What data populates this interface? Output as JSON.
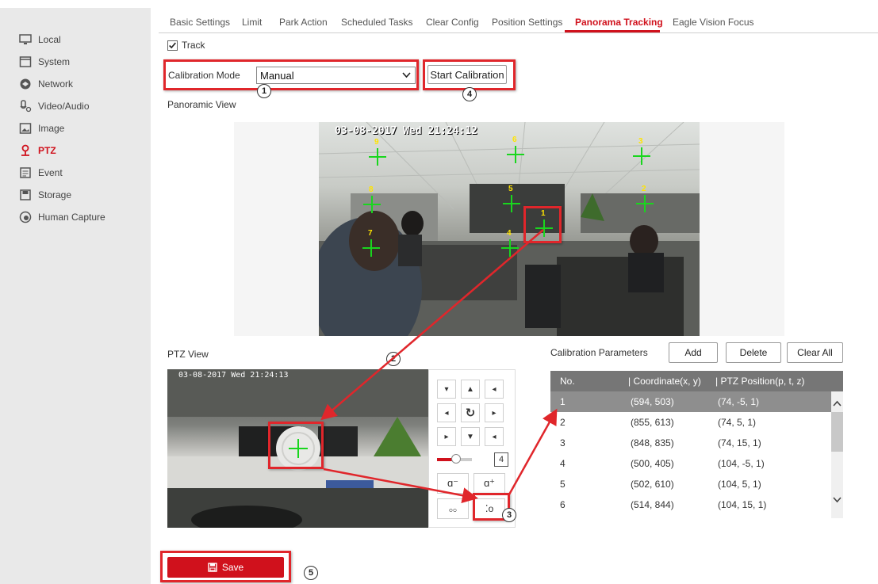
{
  "sidebar": {
    "items": [
      {
        "label": "Local",
        "icon": "monitor-icon"
      },
      {
        "label": "System",
        "icon": "system-icon"
      },
      {
        "label": "Network",
        "icon": "network-icon"
      },
      {
        "label": "Video/Audio",
        "icon": "video-audio-icon"
      },
      {
        "label": "Image",
        "icon": "image-icon"
      },
      {
        "label": "PTZ",
        "icon": "ptz-icon",
        "active": true
      },
      {
        "label": "Event",
        "icon": "event-icon"
      },
      {
        "label": "Storage",
        "icon": "storage-icon"
      },
      {
        "label": "Human Capture",
        "icon": "human-capture-icon"
      }
    ]
  },
  "tabs": [
    "Basic Settings",
    "Limit",
    "Park Action",
    "Scheduled Tasks",
    "Clear Config",
    "Position Settings",
    "Panorama Tracking",
    "Eagle Vision Focus"
  ],
  "active_tab": "Panorama Tracking",
  "track": {
    "label": "Track",
    "checked": true
  },
  "calibration": {
    "mode_label": "Calibration Mode",
    "mode_value": "Manual",
    "start_button": "Start Calibration"
  },
  "panoramic": {
    "title": "Panoramic View",
    "osd": "03-08-2017 Wed 21:24:12",
    "markers": [
      "1",
      "2",
      "3",
      "4",
      "5",
      "6",
      "7",
      "8",
      "9"
    ]
  },
  "ptz_view": {
    "title": "PTZ View",
    "osd": "03-08-2017 Wed 21:24:13",
    "speed_value": "4"
  },
  "params": {
    "title": "Calibration Parameters",
    "add": "Add",
    "delete": "Delete",
    "clear_all": "Clear All",
    "columns": [
      "No.",
      "Coordinate(x, y)",
      "PTZ Position(p, t, z)"
    ],
    "rows": [
      {
        "no": "1",
        "coord": "(594, 503)",
        "ptz": "(74, -5, 1)",
        "selected": true
      },
      {
        "no": "2",
        "coord": "(855, 613)",
        "ptz": "(74, 5, 1)"
      },
      {
        "no": "3",
        "coord": "(848, 835)",
        "ptz": "(74, 15, 1)"
      },
      {
        "no": "4",
        "coord": "(500, 405)",
        "ptz": "(104, -5, 1)"
      },
      {
        "no": "5",
        "coord": "(502, 610)",
        "ptz": "(104, 5, 1)"
      },
      {
        "no": "6",
        "coord": "(514, 844)",
        "ptz": "(104, 15, 1)"
      }
    ]
  },
  "save_label": "Save",
  "callouts": [
    "1",
    "2",
    "3",
    "4",
    "5"
  ],
  "colors": {
    "accent": "#d0111c",
    "callout_red": "#e0262b",
    "marker_green": "#19d61e",
    "marker_number": "#ffe400"
  }
}
